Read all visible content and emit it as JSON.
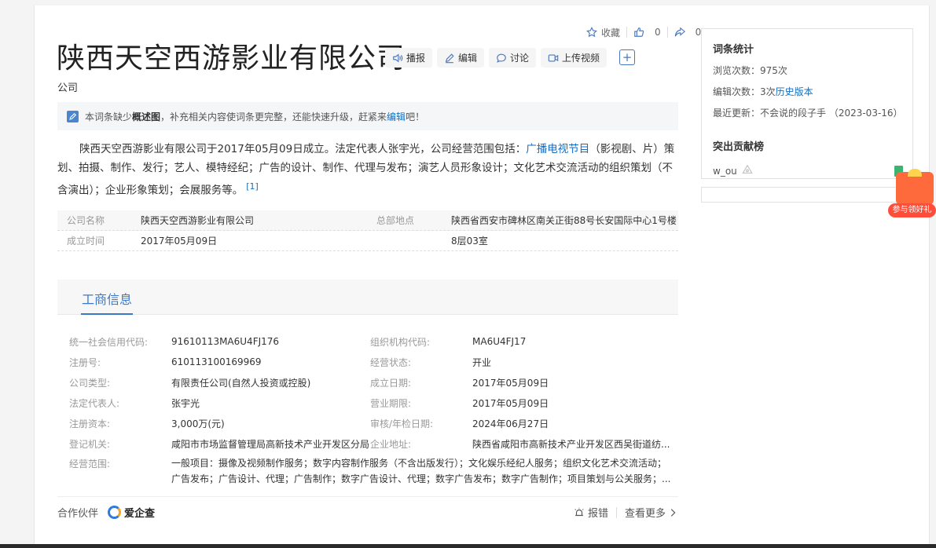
{
  "toolbar": {
    "favorite_label": "收藏",
    "like_count": "0",
    "share_count": "0"
  },
  "title": "陕西天空西游影业有限公司",
  "actions": {
    "broadcast": "播报",
    "edit": "编辑",
    "discuss": "讨论",
    "upload_video": "上传视频",
    "plus": "+"
  },
  "subtitle": "公司",
  "notice": {
    "pre": "本词条缺少",
    "bold": "概述图",
    "mid": "，补充相关内容使词条更完整，还能快速升级，赶紧来",
    "link": "编辑",
    "post": "吧！"
  },
  "summary": {
    "text1": "陕西天空西游影业有限公司于2017年05月09日成立。法定代表人张宇光，公司经营范围包括：",
    "link": "广播电视节目",
    "text2": "（影视剧、片）策划、拍摄、制作、发行；艺人、模特经纪；广告的设计、制作、代理与发布；演艺人员形象设计；文化艺术交流活动的组织策划（不含演出）；企业形象策划；会展服务等。",
    "ref": "[1]"
  },
  "basic_info": {
    "name_label": "公司名称",
    "name_value": "陕西天空西游影业有限公司",
    "hq_label": "总部地点",
    "hq_value_line1": "陕西省西安市碑林区南关正街88号长安国际中心1号楼",
    "hq_value_line2": "8层03室",
    "founded_label": "成立时间",
    "founded_value": "2017年05月09日"
  },
  "biz_tab": "工商信息",
  "biz": {
    "credit_code_label": "统一社会信用代码:",
    "credit_code": "91610113MA6U4FJ176",
    "org_code_label": "组织机构代码:",
    "org_code": "MA6U4FJ17",
    "reg_no_label": "注册号:",
    "reg_no": "610113100169969",
    "status_label": "经营状态:",
    "status": "开业",
    "type_label": "公司类型:",
    "type": "有限责任公司(自然人投资或控股)",
    "est_date_label": "成立日期:",
    "est_date": "2017年05月09日",
    "legal_rep_label": "法定代表人:",
    "legal_rep": "张宇光",
    "term_label": "营业期限:",
    "term": "2017年05月09日",
    "capital_label": "注册资本:",
    "capital": "3,000万(元)",
    "audit_label": "审核/年检日期:",
    "audit": "2024年06月27日",
    "authority_label": "登记机关:",
    "authority": "咸阳市市场监督管理局高新技术产业开发区分局",
    "address_label": "企业地址:",
    "address": "陕西省咸阳市高新技术产业开发区西吴街道纺...",
    "scope_label": "经营范围:",
    "scope_line1": "一般项目：摄像及视频制作服务；数字内容制作服务（不含出版发行）；文化娱乐经纪人服务；组织文化艺术交流活动；",
    "scope_line2": "广告发布；广告设计、代理；广告制作；数字广告设计、代理；数字广告发布；数字广告制作；项目策划与公关服务；..."
  },
  "partner": {
    "label": "合作伙伴",
    "logo_text": "爱企查",
    "report": "报错",
    "more": "查看更多"
  },
  "side": {
    "stats_title": "词条统计",
    "views": "浏览次数：975次",
    "edits_pre": "编辑次数：3次",
    "edits_link": "历史版本",
    "updated": "最近更新：不会说的段子手 （2023-03-16）",
    "contrib_title": "突出贡献榜",
    "contributor": "w_ou"
  },
  "gift": {
    "label": "参与领好礼"
  }
}
